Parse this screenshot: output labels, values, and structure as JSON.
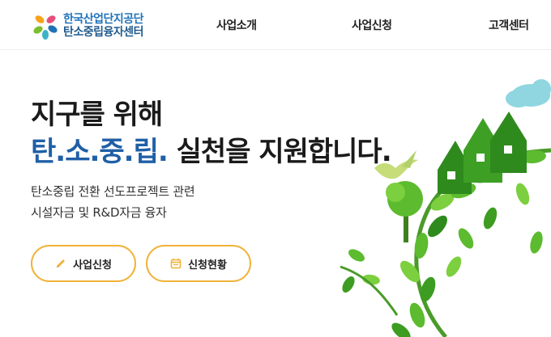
{
  "header": {
    "logo": {
      "line1": "한국산업단지공단",
      "line2": "탄소중립융자센터",
      "icon": "kicox-logo-icon"
    },
    "nav": [
      {
        "label": "사업소개"
      },
      {
        "label": "사업신청"
      },
      {
        "label": "고객센터"
      }
    ]
  },
  "hero": {
    "title_line1": "지구를 위해",
    "title_line2_accent": "탄.소.중.립.",
    "title_line2_rest": "실천을 지원합니다.",
    "description": [
      "탄소중립 전환 선도프로젝트 관련",
      "시설자금 및 R&D자금 융자"
    ],
    "buttons": [
      {
        "label": "사업신청",
        "icon": "pencil-icon"
      },
      {
        "label": "신청현황",
        "icon": "calendar-icon"
      }
    ]
  },
  "colors": {
    "accent_blue": "#1f5fa6",
    "button_border": "#f0b33a",
    "leaf_green": "#5cbb2e",
    "dark_green": "#2f8a1d",
    "cloud": "#8fd6e0"
  }
}
